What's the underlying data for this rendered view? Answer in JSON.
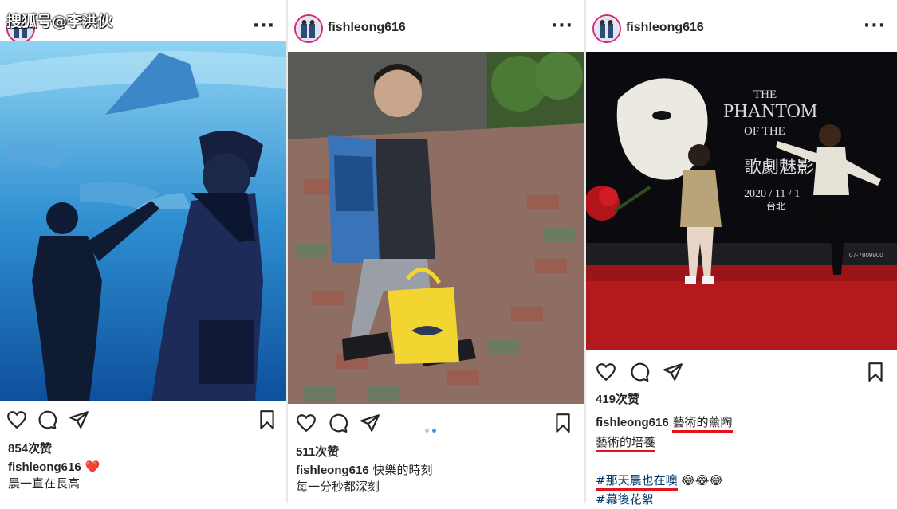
{
  "watermark": "搜狐号@李洪伙",
  "posts": [
    {
      "username": "",
      "more": "···",
      "likes": "854次赞",
      "caption_user": "fishleong616",
      "caption_emoji": "❤️",
      "caption_line2": "晨一直在長高",
      "photo": "aquarium-silhouettes-photo"
    },
    {
      "username": "fishleong616",
      "more": "···",
      "likes": "511次赞",
      "caption_user": "fishleong616",
      "caption_text": "快樂的時刻",
      "caption_line2": "每一分秒都深刻",
      "photo": "boy-with-backpack-photo",
      "carousel_dots": 2
    },
    {
      "username": "fishleong616",
      "more": "···",
      "likes": "419次赞",
      "caption_user": "fishleong616",
      "caption_text": "藝術的薰陶",
      "caption_line2": "藝術的培養",
      "hashtag1": "#那天晨也在噢",
      "hashtag1_emoji": "😂😂😂",
      "hashtag2": "#幕後花絮",
      "photo": "phantom-of-the-opera-backdrop-photo",
      "poster_title": "THE PHANTOM OF THE OPERA",
      "poster_subtitle": "歌劇魅影",
      "poster_date": "2020 / 11 / 1",
      "poster_place": "台北",
      "poster_contact": "07-7809900"
    }
  ],
  "colors": {
    "accent_underline": "#e4111f",
    "hashtag": "#00376b",
    "carousel_active": "#3897f0",
    "carousel_inactive": "#c7c7c7"
  }
}
